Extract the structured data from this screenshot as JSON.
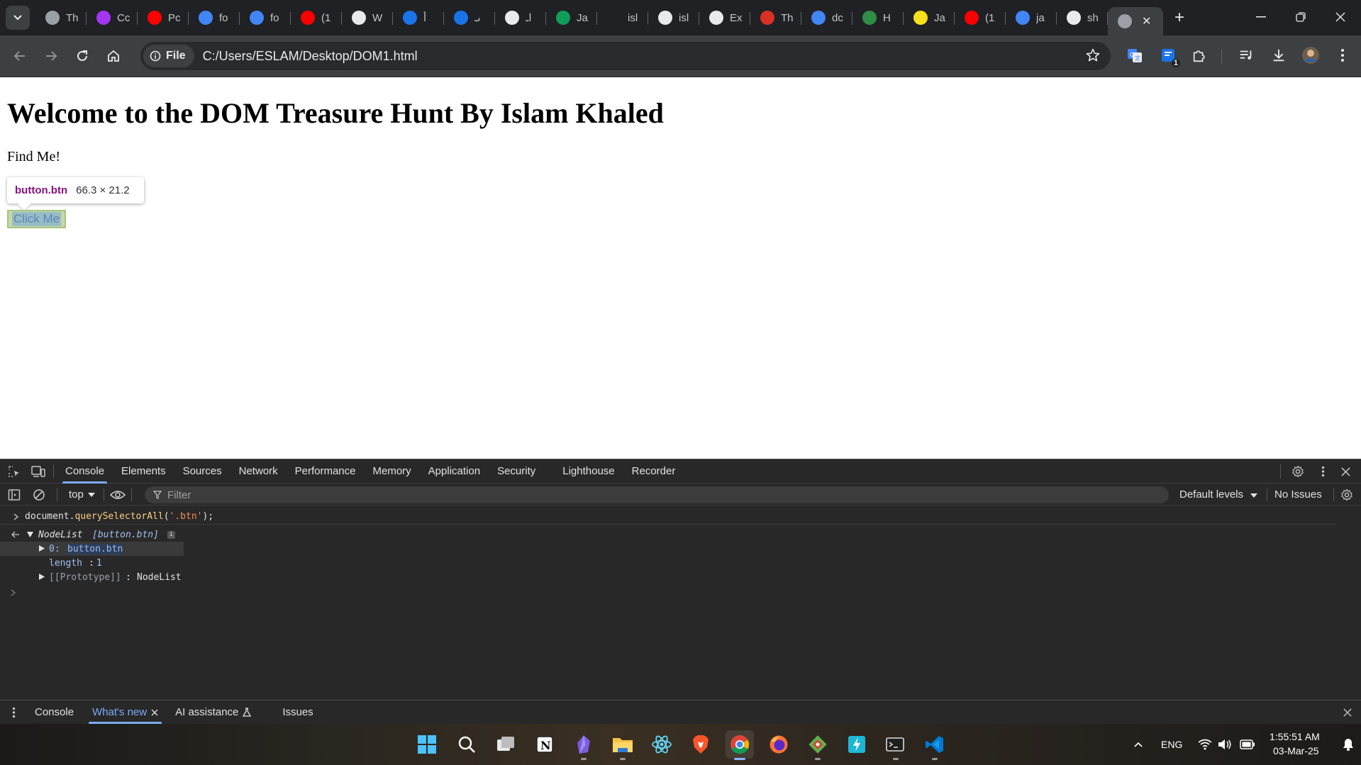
{
  "browser": {
    "tabs": [
      {
        "favicon": "globe-icon",
        "title": "Th",
        "color": "#9aa0a6"
      },
      {
        "favicon": "udemy-icon",
        "title": "Cc",
        "color": "#a435f0"
      },
      {
        "favicon": "youtube-icon",
        "title": "Pc",
        "color": "#ff0000"
      },
      {
        "favicon": "google-icon",
        "title": "fo",
        "color": "#4285f4"
      },
      {
        "favicon": "google-icon",
        "title": "fo",
        "color": "#4285f4"
      },
      {
        "favicon": "youtube-icon",
        "title": "(1",
        "color": "#ff0000"
      },
      {
        "favicon": "search-pin-icon",
        "title": "W",
        "color": "#e8eaed"
      },
      {
        "favicon": "e-letter-icon",
        "title": "أ",
        "color": "#1a73e8"
      },
      {
        "favicon": "e-letter-icon",
        "title": "ىـ",
        "color": "#1a73e8"
      },
      {
        "favicon": "openai-icon",
        "title": "اـ",
        "color": "#e8eaed"
      },
      {
        "favicon": "w-letter-icon",
        "title": "Ja",
        "color": "#0f9d58"
      },
      {
        "favicon": "circle-icon",
        "title": "isl",
        "color": "#202124"
      },
      {
        "favicon": "github-icon",
        "title": "isl",
        "color": "#e8eaed"
      },
      {
        "favicon": "m-letter-icon",
        "title": "Ex",
        "color": "#e8eaed"
      },
      {
        "favicon": "person-icon",
        "title": "Th",
        "color": "#d93025"
      },
      {
        "favicon": "google-icon",
        "title": "dc",
        "color": "#4285f4"
      },
      {
        "favicon": "gfg-icon",
        "title": "H",
        "color": "#2f8d46"
      },
      {
        "favicon": "js-icon",
        "title": "Ja",
        "color": "#f7df1e"
      },
      {
        "favicon": "youtube-icon",
        "title": "(1",
        "color": "#ff0000"
      },
      {
        "favicon": "google-icon",
        "title": "ja",
        "color": "#4285f4"
      },
      {
        "favicon": "github-icon",
        "title": "sh",
        "color": "#e8eaed"
      }
    ],
    "active_tab": {
      "favicon": "globe-icon",
      "close": "✕"
    },
    "new_tab": "+",
    "window_controls": {
      "minimize": "—",
      "restore": "❐",
      "close": "✕"
    },
    "omnibox": {
      "chip_label": "File",
      "url": "C:/Users/ESLAM/Desktop/DOM1.html"
    },
    "extension_badge": "1"
  },
  "page": {
    "heading": "Welcome to the DOM Treasure Hunt By Islam Khaled",
    "text": "Find Me!",
    "inspect_tooltip": {
      "selector": "button.btn",
      "size": "66.3 × 21.2"
    },
    "button_label": "Click Me"
  },
  "devtools": {
    "tabs": [
      "Console",
      "Elements",
      "Sources",
      "Network",
      "Performance",
      "Memory",
      "Application",
      "Security",
      "Lighthouse",
      "Recorder"
    ],
    "active_tab": "Console",
    "console_toolbar": {
      "context": "top",
      "filter_placeholder": "Filter",
      "levels": "Default levels",
      "issues": "No Issues"
    },
    "console": {
      "input": {
        "obj": "document.",
        "method": "querySelectorAll",
        "open": "(",
        "arg": "'.btn'",
        "close": ");"
      },
      "result_header": {
        "type": "NodeList",
        "items": "[button.btn]"
      },
      "entry0": {
        "key": "0:",
        "value": "button.btn"
      },
      "length": {
        "key": "length",
        "value": "1"
      },
      "prototype": {
        "key": "[[Prototype]]",
        "value": "NodeList"
      }
    },
    "drawer": {
      "tabs": [
        "Console",
        "What's new",
        "AI assistance",
        "Issues"
      ],
      "active_tab": "What's new"
    }
  },
  "taskbar": {
    "apps": [
      "windows-start-icon",
      "search-icon",
      "task-view-icon",
      "notion-icon",
      "obsidian-icon",
      "file-explorer-icon",
      "react-icon",
      "brave-icon",
      "chrome-icon",
      "firefox-icon",
      "git-icon",
      "thunder-icon",
      "terminal-icon",
      "vscode-icon"
    ],
    "tray": {
      "language": "ENG",
      "time": "1:55:51 AM",
      "date": "03-Mar-25"
    }
  }
}
